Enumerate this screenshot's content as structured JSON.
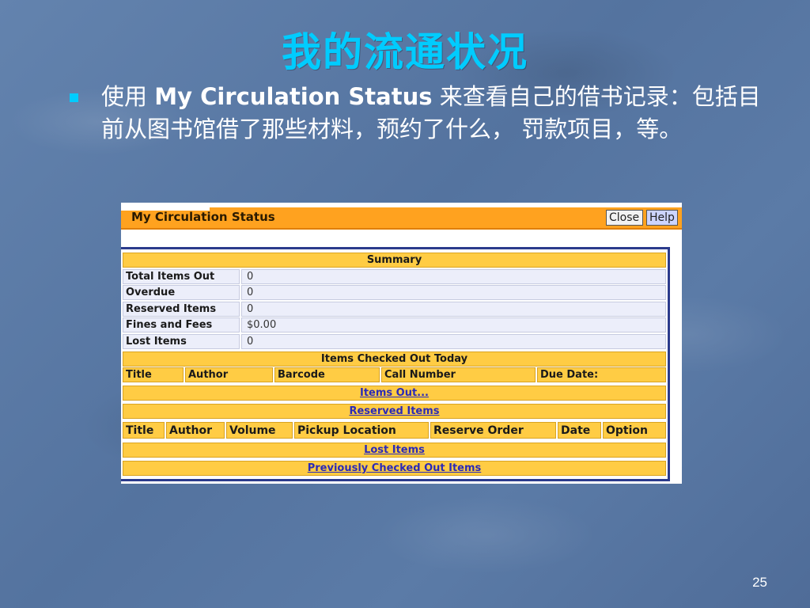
{
  "slide": {
    "title": "我的流通状况",
    "bullet": {
      "prefix": "使用 ",
      "highlight": "My Circulation Status",
      "rest": " 来查看自己的借书记录：包括目前从图书馆借了那些材料，预约了什么， 罚款项目，等。"
    },
    "page_number": "25"
  },
  "panel": {
    "title": "My Circulation Status",
    "close_label": "Close",
    "help_label": "Help",
    "summary_heading": "Summary",
    "summary_rows": [
      {
        "label": "Total Items Out",
        "value": "0"
      },
      {
        "label": "Overdue",
        "value": "0"
      },
      {
        "label": "Reserved Items",
        "value": "0"
      },
      {
        "label": "Fines and Fees",
        "value": "$0.00"
      },
      {
        "label": "Lost Items",
        "value": "0"
      }
    ],
    "checked_out_today_heading": "Items Checked Out Today",
    "checked_out_columns": [
      "Title",
      "Author",
      "Barcode",
      "Call Number",
      "Due Date:"
    ],
    "items_out_link": "Items Out...",
    "reserved_items_link": "Reserved Items",
    "reserved_columns": [
      "Title",
      "Author",
      "Volume",
      "Pickup Location",
      "Reserve Order",
      "Date",
      "Option"
    ],
    "lost_items_link": "Lost Items",
    "previously_checked_out_link": "Previously Checked Out Items"
  }
}
